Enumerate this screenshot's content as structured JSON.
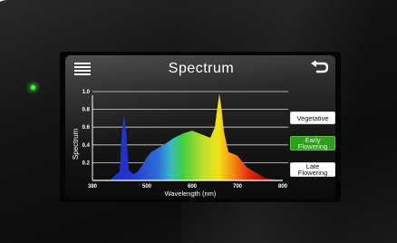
{
  "screen": {
    "title": "Spectrum",
    "menu_icon": "hamburger-menu-icon",
    "back_icon": "return-arrow-icon"
  },
  "indicator": {
    "color": "#3aff3a"
  },
  "presets": {
    "vegetative": "Vegetative",
    "early_flowering": "Early Flowering",
    "late_flowering": "Late Flowering",
    "selected": "early_flowering",
    "selected_color": "#2f9e1f"
  },
  "chart_data": {
    "type": "area",
    "xlabel": "Wavelength (nm)",
    "ylabel": "Spectrum",
    "x_ticks": [
      "380",
      "500",
      "600",
      "700",
      "800"
    ],
    "y_ticks": [
      "1.0",
      "0.8",
      "0.6",
      "0.4",
      "0.2"
    ],
    "xlim": [
      380,
      800
    ],
    "ylim": [
      0,
      1.0
    ],
    "grid": "horizontal",
    "x": [
      380,
      420,
      440,
      445,
      450,
      455,
      460,
      470,
      480,
      490,
      500,
      510,
      520,
      540,
      560,
      580,
      600,
      620,
      640,
      650,
      655,
      660,
      665,
      670,
      680,
      700,
      720,
      760,
      800
    ],
    "y": [
      0.0,
      0.01,
      0.1,
      0.55,
      0.74,
      0.5,
      0.12,
      0.07,
      0.1,
      0.17,
      0.26,
      0.32,
      0.35,
      0.41,
      0.48,
      0.53,
      0.56,
      0.52,
      0.48,
      0.6,
      0.8,
      0.98,
      0.8,
      0.55,
      0.32,
      0.28,
      0.15,
      0.03,
      0.0
    ]
  }
}
